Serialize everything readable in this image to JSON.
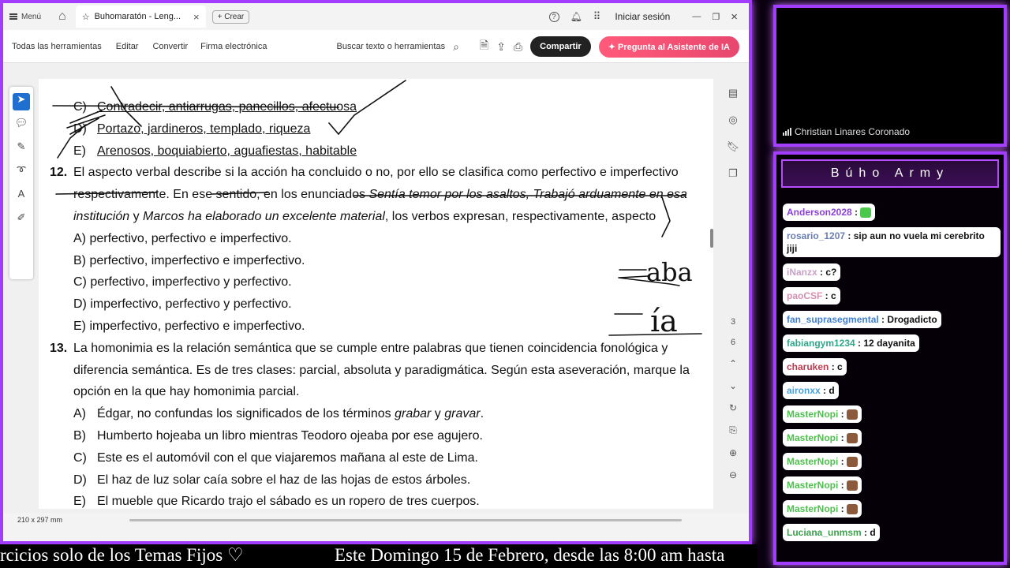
{
  "app": {
    "menu_label": "Menú",
    "tab_title": "Buhomaratón - Leng...",
    "create_label": "Crear",
    "login_label": "Iniciar sesión"
  },
  "toolbar": {
    "items": [
      "Todas las herramientas",
      "Editar",
      "Convertir",
      "Firma electrónica"
    ],
    "search_label": "Buscar texto o herramientas",
    "share_label": "Compartir",
    "ai_label": "Pregunta al Asistente de IA"
  },
  "page_nav": {
    "current": "3",
    "total": "6"
  },
  "status": {
    "page_size": "210 x 297 mm"
  },
  "document": {
    "prev_options": [
      {
        "letter": "C)",
        "text": "Contradecir, antiarrugas, panecillos, afectuosa"
      },
      {
        "letter": "D)",
        "text": "Portazo, jardineros, templado, riqueza"
      },
      {
        "letter": "E)",
        "text": "Arenosos, boquiabierto, aguafiestas, habitable"
      }
    ],
    "q12": {
      "number": "12.",
      "line1": "El aspecto verbal describe si la acción ha concluido o no, por ello se clasifica como perfectivo e imperfectivo",
      "line2_a": "respectivamente. En ese sentido, en los enunciados ",
      "line2_b": "Sentía temor por los asaltos, Trabajó arduamente en esa",
      "line3_a": "institución",
      "line3_b": " y ",
      "line3_c": "Marcos ha elaborado un excelente material",
      "line3_d": ", los verbos expresan, respectivamente, aspecto",
      "options": [
        "A) perfectivo, perfectivo e imperfectivo.",
        "B) perfectivo, imperfectivo e imperfectivo.",
        "C) perfectivo, imperfectivo y perfectivo.",
        "D) imperfectivo, perfectivo y perfectivo.",
        "E) imperfectivo, perfectivo e imperfectivo."
      ]
    },
    "q13": {
      "number": "13.",
      "line1": "La homonimia es la relación semántica que se cumple entre palabras que tienen coincidencia fonológica y",
      "line2": "diferencia semántica. Es de tres clases: parcial, absoluta y paradigmática. Según esta aseveración, marque la",
      "line3": "opción en la que hay homonimia parcial.",
      "opt_a_letter": "A)",
      "opt_a_1": "Édgar, no confundas los significados de los términos ",
      "opt_a_2": "grabar",
      "opt_a_3": " y ",
      "opt_a_4": "gravar",
      "opt_a_5": ".",
      "options": [
        {
          "letter": "B)",
          "text": "Humberto hojeaba un libro mientras Teodoro ojeaba por ese agujero."
        },
        {
          "letter": "C)",
          "text": "Este es el automóvil con el que viajaremos mañana al este de Lima."
        },
        {
          "letter": "D)",
          "text": "El haz de luz solar caía sobre el haz de las hojas de estos árboles."
        },
        {
          "letter": "E)",
          "text": "El mueble que Ricardo trajo el sábado es un ropero de tres cuerpos."
        }
      ]
    },
    "handwriting": [
      "—aba",
      "—ía"
    ]
  },
  "ticker": {
    "left": "rcicios solo de los Temas Fijos ♡",
    "right": "Este Domingo 15 de Febrero, desde las 8:00 am hasta"
  },
  "camera": {
    "name": "Christian Linares Coronado"
  },
  "chat": {
    "title": "Búho Army",
    "messages": [
      {
        "user": "Anderson2028",
        "color": "#8a3fd8",
        "text": ":",
        "emoji": "green-face"
      },
      {
        "user": "rosario_1207",
        "color": "#6a7fb0",
        "text": ": sip aun no vuela mi cerebrito jiji"
      },
      {
        "user": "iNanzx",
        "color": "#c9a0c8",
        "text": ": c?"
      },
      {
        "user": "paoCSF",
        "color": "#d78fb0",
        "text": ": c"
      },
      {
        "user": "fan_suprasegmental",
        "color": "#3f7fd0",
        "text": ": Drogadicto"
      },
      {
        "user": "fabiangym1234",
        "color": "#2fa88a",
        "text": ": 12 dayanita"
      },
      {
        "user": "charuken",
        "color": "#c0394f",
        "text": ": c"
      },
      {
        "user": "aironxx",
        "color": "#4aa0d8",
        "text": ": d"
      },
      {
        "user": "MasterNopi",
        "color": "#4fbf4f",
        "text": ":",
        "emoji": "owl"
      },
      {
        "user": "MasterNopi",
        "color": "#4fbf4f",
        "text": ":",
        "emoji": "owl"
      },
      {
        "user": "MasterNopi",
        "color": "#4fbf4f",
        "text": ":",
        "emoji": "owl"
      },
      {
        "user": "MasterNopi",
        "color": "#4fbf4f",
        "text": ":",
        "emoji": "owl"
      },
      {
        "user": "MasterNopi",
        "color": "#4fbf4f",
        "text": ":",
        "emoji": "owl"
      },
      {
        "user": "Luciana_unmsm",
        "color": "#3fa04f",
        "text": ": d"
      }
    ]
  },
  "colors": {
    "accent": "#a23dff",
    "share": "#222222",
    "ai": "#e8476e"
  }
}
